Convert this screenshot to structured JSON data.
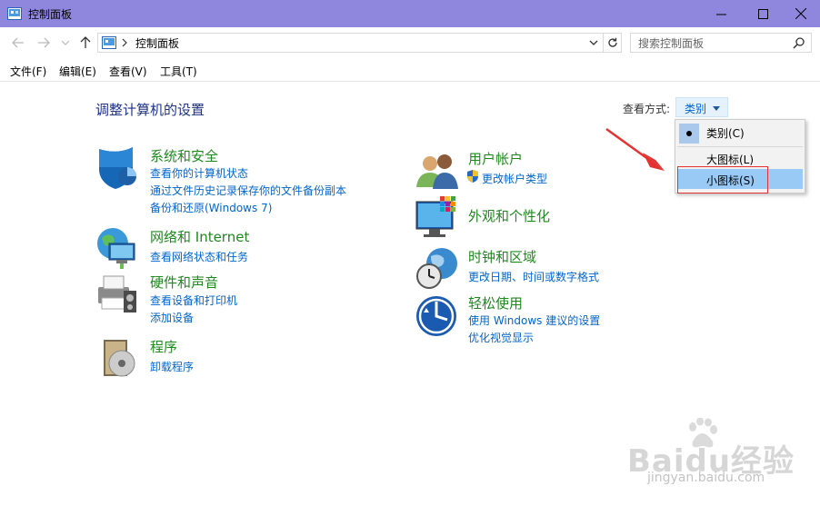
{
  "window": {
    "title": "控制面板"
  },
  "address": {
    "path": "控制面板",
    "search_placeholder": "搜索控制面板"
  },
  "menu": [
    "文件(F)",
    "编辑(E)",
    "查看(V)",
    "工具(T)"
  ],
  "content": {
    "page_title": "调整计算机的设置",
    "view_by_label": "查看方式:",
    "view_by_value": "类别"
  },
  "dropdown": {
    "options": [
      "类别(C)",
      "大图标(L)",
      "小图标(S)"
    ],
    "selected": "类别(C)",
    "highlighted": "小图标(S)"
  },
  "categories": [
    {
      "title": "系统和安全",
      "links": [
        "查看你的计算机状态",
        "通过文件历史记录保存你的文件备份副本",
        "备份和还原(Windows 7)"
      ]
    },
    {
      "title": "网络和 Internet",
      "links": [
        "查看网络状态和任务"
      ]
    },
    {
      "title": "硬件和声音",
      "links": [
        "查看设备和打印机",
        "添加设备"
      ]
    },
    {
      "title": "程序",
      "links": [
        "卸载程序"
      ]
    },
    {
      "title": "用户帐户",
      "links": [
        "更改帐户类型"
      ]
    },
    {
      "title": "外观和个性化",
      "links": []
    },
    {
      "title": "时钟和区域",
      "links": [
        "更改日期、时间或数字格式"
      ]
    },
    {
      "title": "轻松使用",
      "links": [
        "使用 Windows 建议的设置",
        "优化视觉显示"
      ]
    }
  ],
  "watermark": {
    "text": "Baidu经验",
    "url": "jingyan.baidu.com"
  },
  "colors": {
    "titlebar": "#8f87dd",
    "link": "#0066cc",
    "category_title": "#1e8a1e",
    "page_title": "#1e3287",
    "annotation_red": "#e3322f"
  }
}
